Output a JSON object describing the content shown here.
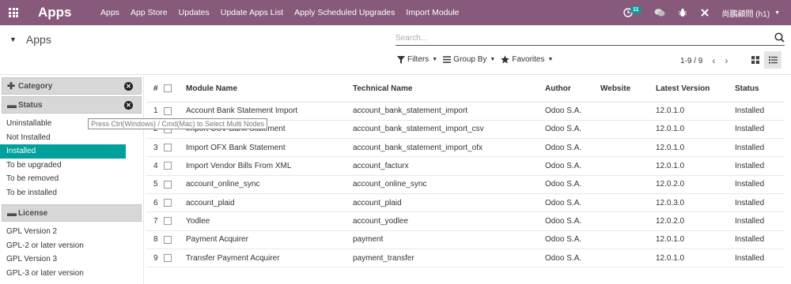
{
  "nav": {
    "brand": "Apps",
    "menu": [
      "Apps",
      "App Store",
      "Updates",
      "Update Apps List",
      "Apply Scheduled Upgrades",
      "Import Module"
    ],
    "activity_badge": "11",
    "user": "尚鵬顧問 (h1)",
    "bar_color": "#875a7b"
  },
  "control_panel": {
    "breadcrumb": "Apps",
    "search_placeholder": "Search...",
    "filters_label": "Filters",
    "group_by_label": "Group By",
    "favorites_label": "Favorites",
    "pager": "1-9 / 9"
  },
  "sidebar": {
    "category_label": "Category",
    "status_label": "Status",
    "status_options": [
      "Uninstallable",
      "Not Installed",
      "Installed",
      "To be upgraded",
      "To be removed",
      "To be installed"
    ],
    "selected_status": "Installed",
    "license_label": "License",
    "license_options": [
      "GPL Version 2",
      "GPL-2 or later version",
      "GPL Version 3",
      "GPL-3 or later version"
    ],
    "tooltip": "Press Ctrl(Windows) / Cmd(Mac) to Select Multi Nodes",
    "accent_color": "#00a09d"
  },
  "table": {
    "headers": [
      "#",
      "Module Name",
      "Technical Name",
      "Author",
      "Website",
      "Latest Version",
      "Status"
    ],
    "rows": [
      {
        "num": "1",
        "name": "Account Bank Statement Import",
        "tech": "account_bank_statement_import",
        "author": "Odoo S.A.",
        "website": "",
        "version": "12.0.1.0",
        "status": "Installed"
      },
      {
        "num": "2",
        "name": "Import CSV Bank Statement",
        "tech": "account_bank_statement_import_csv",
        "author": "Odoo S.A.",
        "website": "",
        "version": "12.0.1.0",
        "status": "Installed"
      },
      {
        "num": "3",
        "name": "Import OFX Bank Statement",
        "tech": "account_bank_statement_import_ofx",
        "author": "Odoo S.A.",
        "website": "",
        "version": "12.0.1.0",
        "status": "Installed"
      },
      {
        "num": "4",
        "name": "Import Vendor Bills From XML",
        "tech": "account_facturx",
        "author": "Odoo S.A.",
        "website": "",
        "version": "12.0.1.0",
        "status": "Installed"
      },
      {
        "num": "5",
        "name": "account_online_sync",
        "tech": "account_online_sync",
        "author": "Odoo S.A.",
        "website": "",
        "version": "12.0.2.0",
        "status": "Installed"
      },
      {
        "num": "6",
        "name": "account_plaid",
        "tech": "account_plaid",
        "author": "Odoo S.A.",
        "website": "",
        "version": "12.0.3.0",
        "status": "Installed"
      },
      {
        "num": "7",
        "name": "Yodlee",
        "tech": "account_yodlee",
        "author": "Odoo S.A.",
        "website": "",
        "version": "12.0.2.0",
        "status": "Installed"
      },
      {
        "num": "8",
        "name": "Payment Acquirer",
        "tech": "payment",
        "author": "Odoo S.A.",
        "website": "",
        "version": "12.0.1.0",
        "status": "Installed"
      },
      {
        "num": "9",
        "name": "Transfer Payment Acquirer",
        "tech": "payment_transfer",
        "author": "Odoo S.A.",
        "website": "",
        "version": "12.0.1.0",
        "status": "Installed"
      }
    ]
  }
}
